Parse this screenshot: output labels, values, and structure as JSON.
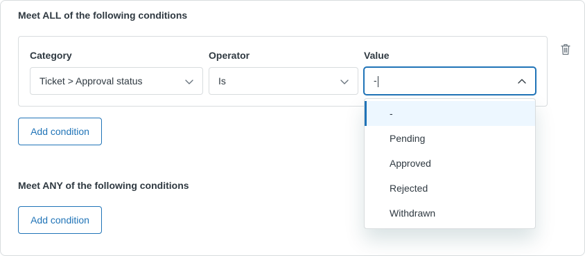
{
  "all_section": {
    "title": "Meet ALL of the following conditions",
    "add_button": "Add condition"
  },
  "any_section": {
    "title": "Meet ANY of the following conditions",
    "add_button": "Add condition"
  },
  "condition": {
    "category": {
      "label": "Category",
      "value": "Ticket > Approval status"
    },
    "operator": {
      "label": "Operator",
      "value": "Is"
    },
    "value": {
      "label": "Value",
      "current": "-"
    }
  },
  "value_dropdown": {
    "options": [
      "-",
      "Pending",
      "Approved",
      "Rejected",
      "Withdrawn"
    ],
    "selected_index": 0
  },
  "colors": {
    "accent": "#1f73b7",
    "border": "#d8dcde",
    "text": "#2f3941",
    "hover": "#edf7ff"
  },
  "icons": {
    "chevron_down": "chevron-down-icon",
    "chevron_up": "chevron-up-icon",
    "trash": "trash-icon"
  }
}
